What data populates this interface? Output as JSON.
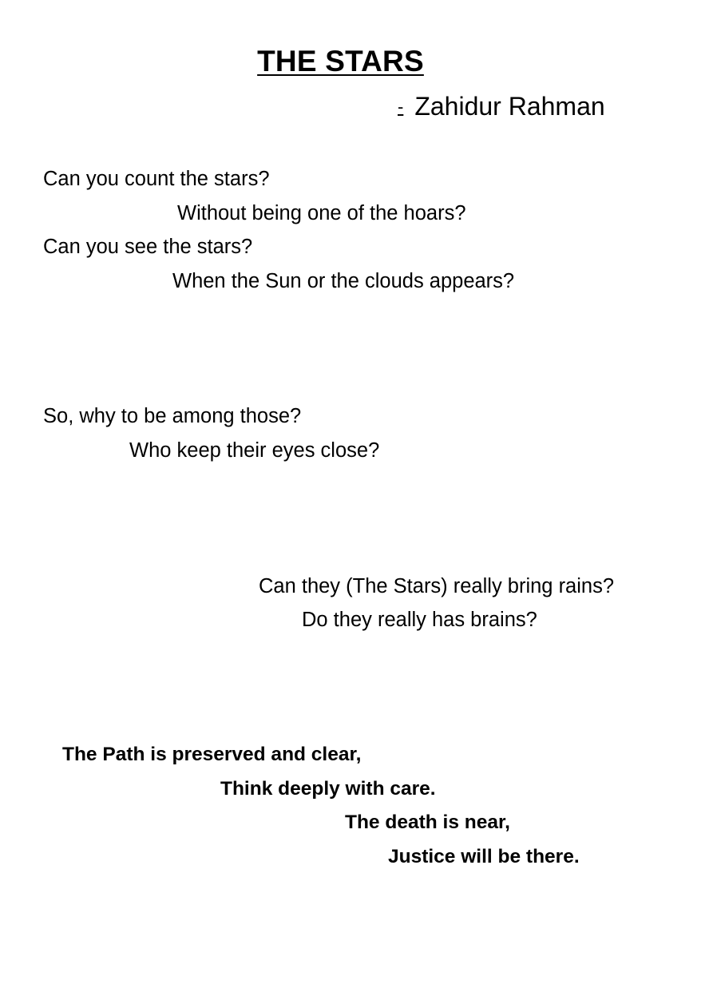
{
  "title": "THE STARS",
  "author": {
    "dash": "-",
    "name": "Zahidur Rahman"
  },
  "stanzas": [
    {
      "lines": [
        "Can you count the stars?",
        "Without being one of the hoars?",
        "Can you see the stars?",
        "When the Sun or the clouds appears?"
      ]
    },
    {
      "lines": [
        "So, why to be among those?",
        "Who keep their eyes close?"
      ]
    },
    {
      "lines": [
        "Can they (The Stars) really bring rains?",
        "Do they really has brains?"
      ]
    },
    {
      "lines": [
        "The Path is preserved and clear,",
        "Think deeply with care.",
        "The death is near,",
        "Justice will be there."
      ]
    }
  ]
}
